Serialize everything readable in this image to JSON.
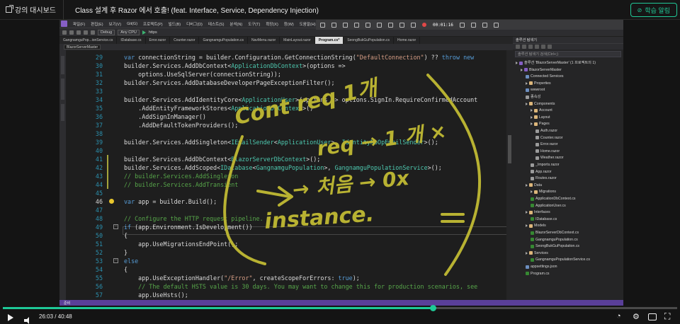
{
  "header": {
    "dashboard_label": "강의 대시보드",
    "lecture_title": "Class 설계 후 Razor 에서 호출! (feat. Interface, Service, Dependency Injection)",
    "learn_alarm_label": "학습 알림"
  },
  "vs": {
    "menu": [
      "파일(F)",
      "편집(E)",
      "보기(V)",
      "Git(G)",
      "프로젝트(P)",
      "빌드(B)",
      "디버그(D)",
      "테스트(S)",
      "분석(N)",
      "도구(T)",
      "확장(X)",
      "창(W)",
      "도움말(H)"
    ],
    "toolbar": {
      "config": "Debug",
      "platform": "Any CPU",
      "run_target": "https"
    },
    "recorder": {
      "timer": "00:01:16"
    },
    "tabs": [
      {
        "label": "GangnamguPop...ionService.cs",
        "active": false
      },
      {
        "label": "IDatabase.cs",
        "active": false
      },
      {
        "label": "Error.razor",
        "active": false
      },
      {
        "label": "Counter.razor",
        "active": false
      },
      {
        "label": "GangnamguPopulation.cs",
        "active": false
      },
      {
        "label": "NavMenu.razor",
        "active": false
      },
      {
        "label": "MainLayout.razor",
        "active": false
      },
      {
        "label": "Program.cs*",
        "active": true
      },
      {
        "label": "SeongBukGuPopulation.cs",
        "active": false
      },
      {
        "label": "Home.razor",
        "active": false
      }
    ],
    "nav_combo": "BlazorServerMaster",
    "status_bar": "준비"
  },
  "code": {
    "lines": [
      {
        "n": "29",
        "t": "var connectionString = builder.Configuration.GetConnectionString(\"DefaultConnection\") ?? throw new"
      },
      {
        "n": "30",
        "t": "builder.Services.AddDbContext<ApplicationDbContext>(options =>"
      },
      {
        "n": "31",
        "t": "    options.UseSqlServer(connectionString));"
      },
      {
        "n": "32",
        "t": "builder.Services.AddDatabaseDeveloperPageExceptionFilter();"
      },
      {
        "n": "33",
        "t": ""
      },
      {
        "n": "34",
        "t": "builder.Services.AddIdentityCore<ApplicationUser>(options => options.SignIn.RequireConfirmedAccount"
      },
      {
        "n": "35",
        "t": "    .AddEntityFrameworkStores<ApplicationDbContext>()"
      },
      {
        "n": "36",
        "t": "    .AddSignInManager()"
      },
      {
        "n": "37",
        "t": "    .AddDefaultTokenProviders();"
      },
      {
        "n": "38",
        "t": ""
      },
      {
        "n": "39",
        "t": "builder.Services.AddSingleton<IEmailSender<ApplicationUser>, IdentityNoOpEmailSender>();"
      },
      {
        "n": "40",
        "t": ""
      },
      {
        "n": "41",
        "t": "builder.Services.AddDbContext<BlazorServerDbContext>();"
      },
      {
        "n": "42",
        "t": "builder.Services.AddScoped<IDatabase<GangnamguPopulation>, GangnamguPopulationService>();"
      },
      {
        "n": "43",
        "t": "// builder.Services.AddSingleton"
      },
      {
        "n": "44",
        "t": "// builder.Services.AddTransient"
      },
      {
        "n": "45",
        "t": ""
      },
      {
        "n": "46",
        "t": "var app = builder.Build();"
      },
      {
        "n": "47",
        "t": ""
      },
      {
        "n": "48",
        "t": "// Configure the HTTP request pipeline."
      },
      {
        "n": "49",
        "t": "if (app.Environment.IsDevelopment())"
      },
      {
        "n": "50",
        "t": "{"
      },
      {
        "n": "51",
        "t": "    app.UseMigrationsEndPoint();"
      },
      {
        "n": "52",
        "t": "}"
      },
      {
        "n": "53",
        "t": "else"
      },
      {
        "n": "54",
        "t": "{"
      },
      {
        "n": "55",
        "t": "    app.UseExceptionHandler(\"/Error\", createScopeForErrors: true);"
      },
      {
        "n": "56",
        "t": "    // The default HSTS value is 30 days. You may want to change this for production scenarios, see"
      },
      {
        "n": "57",
        "t": "    app.UseHsts();"
      }
    ],
    "current_line": "46",
    "handwriting": {
      "line1": "Cont req 1개",
      "line2": "req → 1 개 ×",
      "line3": "→ 처음 → 0x",
      "line4": "instance."
    }
  },
  "solution_explorer": {
    "title": "솔루션 탐색기",
    "search_placeholder": "솔루션 탐색기 검색(Ctrl+;)",
    "items": [
      {
        "label": "솔루션 'BlazorServerMaster' (1 프로젝트의 1)",
        "depth": 0,
        "icon": "solution-icon"
      },
      {
        "label": "BlazorServerMaster",
        "depth": 1,
        "icon": "project-icon"
      },
      {
        "label": "Connected Services",
        "depth": 2,
        "icon": "connected-icon"
      },
      {
        "label": "Properties",
        "depth": 2,
        "icon": "folder-icon"
      },
      {
        "label": "wwwroot",
        "depth": 2,
        "icon": "globe-icon"
      },
      {
        "label": "종속성",
        "depth": 2,
        "icon": "dependency-icon"
      },
      {
        "label": "Components",
        "depth": 2,
        "icon": "folder-icon"
      },
      {
        "label": "Account",
        "depth": 3,
        "icon": "folder-icon"
      },
      {
        "label": "Layout",
        "depth": 3,
        "icon": "folder-icon"
      },
      {
        "label": "Pages",
        "depth": 3,
        "icon": "folder-icon"
      },
      {
        "label": "Auth.razor",
        "depth": 4,
        "icon": "file-icon"
      },
      {
        "label": "Counter.razor",
        "depth": 4,
        "icon": "file-icon"
      },
      {
        "label": "Error.razor",
        "depth": 4,
        "icon": "file-icon"
      },
      {
        "label": "Home.razor",
        "depth": 4,
        "icon": "file-icon"
      },
      {
        "label": "Weather.razor",
        "depth": 4,
        "icon": "file-icon"
      },
      {
        "label": "_Imports.razor",
        "depth": 3,
        "icon": "file-icon"
      },
      {
        "label": "App.razor",
        "depth": 3,
        "icon": "file-icon"
      },
      {
        "label": "Routes.razor",
        "depth": 3,
        "icon": "file-icon"
      },
      {
        "label": "Data",
        "depth": 2,
        "icon": "folder-icon"
      },
      {
        "label": "Migrations",
        "depth": 3,
        "icon": "folder-icon"
      },
      {
        "label": "ApplicationDbContext.cs",
        "depth": 3,
        "icon": "cs-icon"
      },
      {
        "label": "ApplicationUser.cs",
        "depth": 3,
        "icon": "cs-icon"
      },
      {
        "label": "Interfaces",
        "depth": 2,
        "icon": "folder-icon"
      },
      {
        "label": "IDatabase.cs",
        "depth": 3,
        "icon": "cs-icon"
      },
      {
        "label": "Models",
        "depth": 2,
        "icon": "folder-icon"
      },
      {
        "label": "BlazorServerDbContext.cs",
        "depth": 3,
        "icon": "cs-icon"
      },
      {
        "label": "GangnamguPopulation.cs",
        "depth": 3,
        "icon": "cs-icon"
      },
      {
        "label": "SeongBukGuPopulation.cs",
        "depth": 3,
        "icon": "cs-icon"
      },
      {
        "label": "Services",
        "depth": 2,
        "icon": "folder-icon"
      },
      {
        "label": "GangnamguPopulationService.cs",
        "depth": 3,
        "icon": "cs-icon"
      },
      {
        "label": "appsettings.json",
        "depth": 2,
        "icon": "gear-icon"
      },
      {
        "label": "Program.cs",
        "depth": 2,
        "icon": "cs-icon"
      }
    ]
  },
  "player": {
    "current_time": "26:03",
    "total_time": "40:48",
    "separator": "/",
    "progress_fraction": 0.638
  },
  "colors": {
    "accent": "#1ec997",
    "annotation": "#b8b232"
  }
}
